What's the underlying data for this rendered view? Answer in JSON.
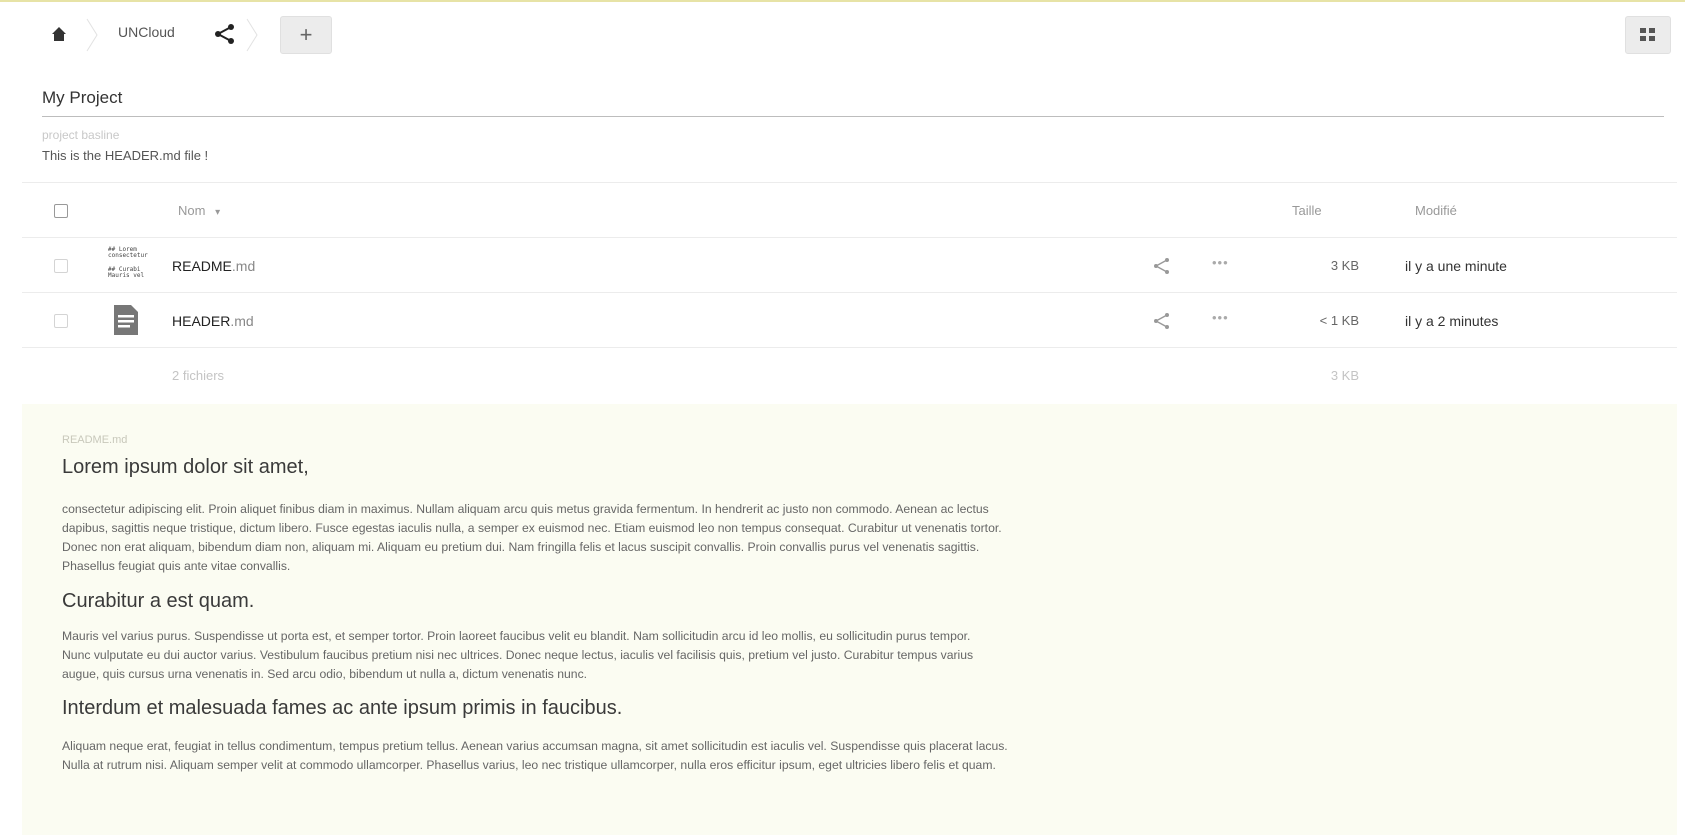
{
  "breadcrumb": {
    "home_icon": "home-icon",
    "folder": "UNCloud",
    "share_icon": "share-icon",
    "add_label": "+"
  },
  "view_toggle_icon": "grid-icon",
  "project": {
    "title": "My Project",
    "baseline_label": "project basline",
    "header_text": "This is the HEADER.md file !"
  },
  "table": {
    "headers": {
      "name": "Nom",
      "sort_indicator": "▾",
      "size": "Taille",
      "modified": "Modifié"
    },
    "rows": [
      {
        "name": "README",
        "ext": ".md",
        "size": "3 KB",
        "modified": "il y a une minute",
        "thumbnail_lines": [
          "## Lorem",
          "consectetur",
          "## Curabi",
          "Mauris vel"
        ]
      },
      {
        "name": "HEADER",
        "ext": ".md",
        "size": "< 1 KB",
        "modified": "il y a 2 minutes",
        "icon": "document-icon"
      }
    ],
    "summary": {
      "count": "2 fichiers",
      "size": "3 KB"
    }
  },
  "readme": {
    "filename": "README.md",
    "sections": [
      {
        "heading": "Lorem ipsum dolor sit amet,",
        "lines": [
          "consectetur adipiscing elit. Proin aliquet finibus diam in maximus. Nullam aliquam arcu quis metus gravida fermentum. In hendrerit ac justo non commodo. Aenean ac lectus",
          "dapibus, sagittis neque tristique, dictum libero. Fusce egestas iaculis nulla, a semper ex euismod nec. Etiam euismod leo non tempus consequat. Curabitur ut venenatis tortor.",
          "Donec non erat aliquam, bibendum diam non, aliquam mi. Aliquam eu pretium dui. Nam fringilla felis et lacus suscipit convallis. Proin convallis purus vel venenatis sagittis.",
          "Phasellus feugiat quis ante vitae convallis."
        ]
      },
      {
        "heading": "Curabitur a est quam.",
        "lines": [
          "Mauris vel varius purus. Suspendisse ut porta est, et semper tortor. Proin laoreet faucibus velit eu blandit. Nam sollicitudin arcu id leo mollis, eu sollicitudin purus tempor.",
          "Nunc vulputate eu dui auctor varius. Vestibulum faucibus pretium nisi nec ultrices. Donec neque lectus, iaculis vel facilisis quis, pretium vel justo. Curabitur tempus varius",
          "augue, quis cursus urna venenatis in. Sed arcu odio, bibendum ut nulla a, dictum venenatis nunc."
        ]
      },
      {
        "heading": "Interdum et malesuada fames ac ante ipsum primis in faucibus.",
        "lines": [
          "Aliquam neque erat, feugiat in tellus condimentum, tempus pretium tellus. Aenean varius accumsan magna, sit amet sollicitudin est iaculis vel. Suspendisse quis placerat lacus.",
          "Nulla at rutrum nisi. Aliquam semper velit at commodo ullamcorper. Phasellus varius, leo nec tristique ullamcorper, nulla eros efficitur ipsum, eget ultricies libero felis et quam."
        ]
      }
    ]
  }
}
